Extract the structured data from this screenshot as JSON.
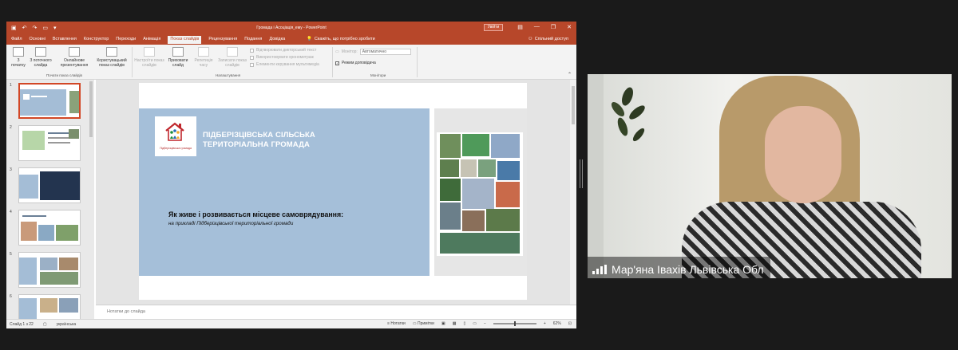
{
  "titlebar": {
    "document_title": "Громада і Асоціація_ему - PowerPoint",
    "signin_label": "Увійти"
  },
  "menu": {
    "tabs": [
      "Файл",
      "Основні",
      "Вставлення",
      "Конструктор",
      "Переходи",
      "Анімація",
      "Показ слайдів",
      "Рецензування",
      "Подання",
      "Довідка"
    ],
    "active_tab": "Показ слайдів",
    "tell_me": "Скажіть, що потрібно зробити",
    "share": "Спільний доступ"
  },
  "ribbon": {
    "buttons": {
      "from_start": "З початку",
      "from_current": "З поточного слайда",
      "online": "Онлайнове презентування",
      "custom": "Користувацький показ слайдів",
      "setup": "Настроїти показ слайдів",
      "hide": "Приховати слайд",
      "rehearse": "Репетиція часу",
      "record": "Записати показ слайдів"
    },
    "checks": {
      "play_narrations": "Відтворювати дикторський текст",
      "use_timings": "Використовувати хронометраж",
      "show_media": "Елементи керування мультимедіа",
      "presenter_view": "Режим доповідача"
    },
    "monitor_label": "Монітор:",
    "monitor_value": "Автоматично",
    "groups": {
      "start": "Почати показ слайдів",
      "setup": "Налаштування",
      "monitors": "Монітори"
    }
  },
  "thumbnails": {
    "numbers": [
      "1",
      "2",
      "3",
      "4",
      "5",
      "6"
    ],
    "active": "1"
  },
  "slide": {
    "org_name": "ПІДБЕРІЗЦІВСЬКА СІЛЬСЬКА ТЕРИТОРІАЛЬНА ГРОМАДА",
    "logo_caption": "Підберізцівська громада",
    "heading": "Як живе і розвивається місцеве самоврядування:",
    "subheading": "на прикладі Підберізцівської територіальної громади"
  },
  "notes": {
    "placeholder": "Нотатки до слайда"
  },
  "status": {
    "slide_counter": "Слайд 1 з 22",
    "language": "українська",
    "notes_btn": "Нотатки",
    "comments_btn": "Примітки",
    "zoom": "62%"
  },
  "participant": {
    "name": "Мар'яна Івахів Львівська Обл"
  },
  "colors": {
    "ppt_accent": "#b7472a",
    "slide_blue": "#a5bfd9"
  }
}
